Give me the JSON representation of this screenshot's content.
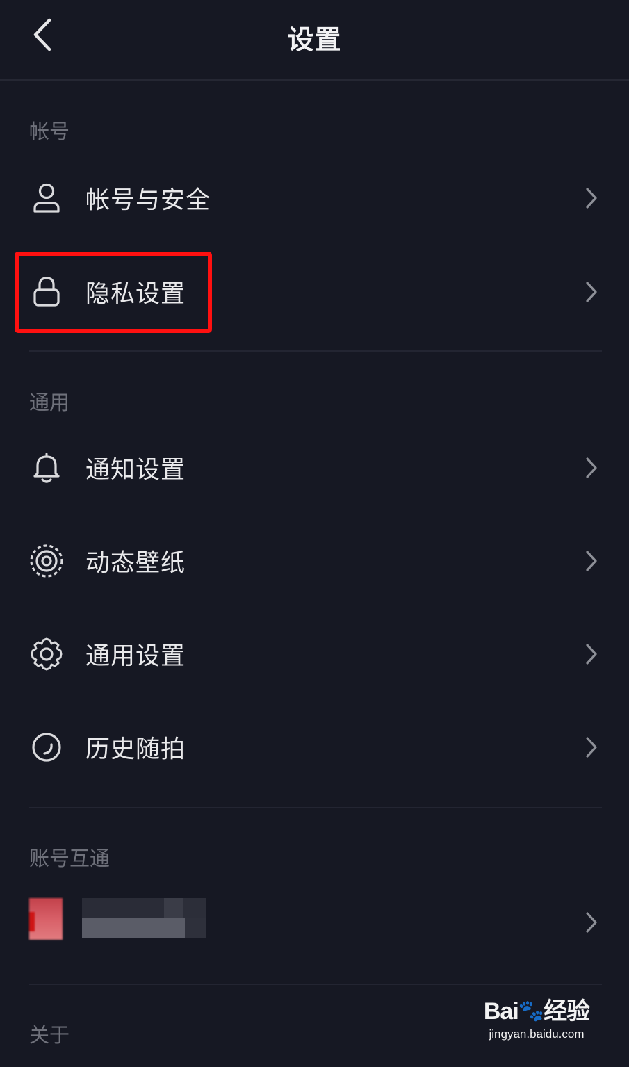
{
  "header": {
    "title": "设置",
    "back_icon": "chevron-left-icon"
  },
  "sections": {
    "account": {
      "label": "帐号",
      "items": [
        {
          "label": "帐号与安全",
          "icon": "user-icon"
        },
        {
          "label": "隐私设置",
          "icon": "lock-icon"
        }
      ]
    },
    "general": {
      "label": "通用",
      "items": [
        {
          "label": "通知设置",
          "icon": "bell-icon"
        },
        {
          "label": "动态壁纸",
          "icon": "live-wallpaper-icon"
        },
        {
          "label": "通用设置",
          "icon": "gear-icon"
        },
        {
          "label": "历史随拍",
          "icon": "history-icon"
        }
      ]
    },
    "linked": {
      "label": "账号互通"
    },
    "about": {
      "label": "关于"
    }
  },
  "highlight": {
    "color": "#ff1010",
    "target": "隐私设置"
  },
  "watermark": {
    "logo_left": "Bai",
    "logo_right": "经验",
    "url": "jingyan.baidu.com"
  },
  "colors": {
    "background": "#161823",
    "text_primary": "#e9e9eb",
    "text_secondary": "#6f717b",
    "divider": "#232532"
  }
}
